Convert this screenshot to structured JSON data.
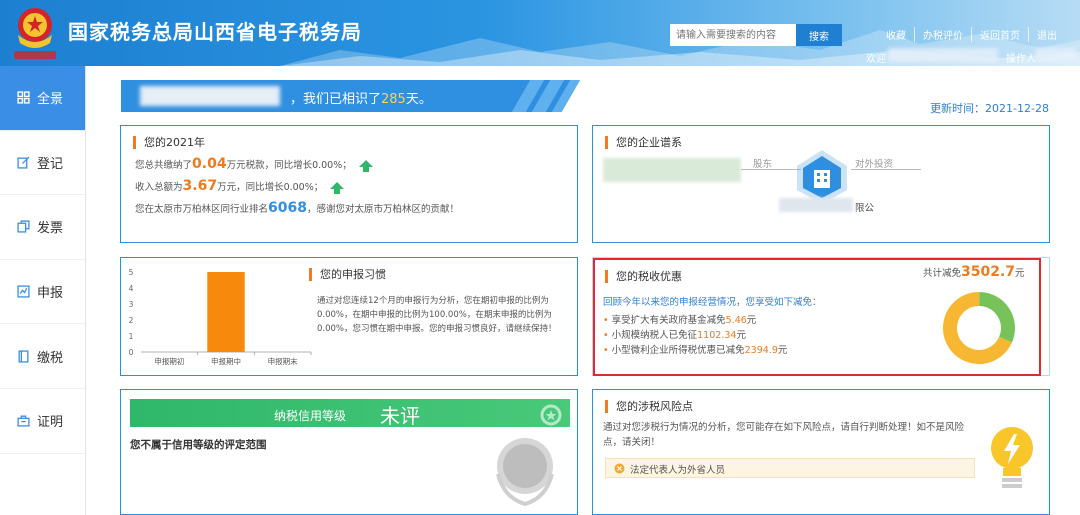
{
  "header": {
    "site_title": "国家税务总局山西省电子税务局",
    "search_placeholder": "请输入需要搜索的内容",
    "search_button": "搜索",
    "links": [
      "收藏",
      "办税评价",
      "返回首页",
      "退出"
    ],
    "welcome": "欢迎",
    "operator": "操作人"
  },
  "sidebar": {
    "items": [
      {
        "label": "全景",
        "icon": "grid-icon",
        "active": true
      },
      {
        "label": "登记",
        "icon": "edit-icon",
        "active": false
      },
      {
        "label": "发票",
        "icon": "copy-icon",
        "active": false
      },
      {
        "label": "申报",
        "icon": "chart-line-icon",
        "active": false
      },
      {
        "label": "缴税",
        "icon": "book-icon",
        "active": false
      },
      {
        "label": "证明",
        "icon": "certificate-icon",
        "active": false
      }
    ]
  },
  "banner": {
    "prefix": "，我们已相识了",
    "days": "285",
    "suffix": "天。"
  },
  "update_time": "更新时间：2021-12-28",
  "year_card": {
    "title": "您的2021年",
    "line1_a": "您总共缴纳了",
    "line1_num": "0.04",
    "line1_b": "万元税款，同比增长0.00%；",
    "line2_a": "收入总额为",
    "line2_num": "3.67",
    "line2_b": "万元，同比增长0.00%；",
    "line3_a": "您在太原市万柏林区同行业排名",
    "line3_num": "6068",
    "line3_b": "，感谢您对太原市万柏林区的贡献！"
  },
  "enterprise_card": {
    "title": "您的企业谱系",
    "shareholder": "股东",
    "investment": "对外投资",
    "company_suffix": "限公"
  },
  "declare_card": {
    "title": "您的申报习惯",
    "text": "通过对您连续12个月的申报行为分析，您在期初申报的比例为0.00%，在期中申报的比例为100.00%，在期末申报的比例为0.00%，您习惯在期中申报。您的申报习惯良好，请继续保持！",
    "text_lines": [
      "通过对您连续12个月的申报行为分析，您在期初申报的比例为",
      "0.00%，在期中申报的比例为100.00%，在期末申报的比例为",
      "0.00%，您习惯在期中申报。您的申报习惯良好，请继续保持！"
    ]
  },
  "chart_data": {
    "type": "bar",
    "categories": [
      "申报期初",
      "申报期中",
      "申报期末"
    ],
    "values": [
      0,
      5,
      0
    ],
    "ylim": [
      0,
      5
    ],
    "yticks": [
      "0",
      "1",
      "2",
      "3",
      "4",
      "5"
    ],
    "color": "#f7890c",
    "grid": false
  },
  "tax_card": {
    "title": "您的税收优惠",
    "total_label": "共计减免",
    "total_value": "3502.7",
    "total_unit": "元",
    "intro": "回顾今年以来您的申报经营情况，您享受如下减免：",
    "items": [
      {
        "text": "享受扩大有关政府基金减免",
        "value": "5.46",
        "unit": "元"
      },
      {
        "text": "小规模纳税人已免征",
        "value": "1102.34",
        "unit": "元"
      },
      {
        "text": "小型微利企业所得税优惠已减免",
        "value": "2394.9",
        "unit": "元"
      }
    ],
    "donut": {
      "values": [
        5.46,
        1102.34,
        2394.9
      ],
      "colors": [
        "#f7b733",
        "#78c25a",
        "#f7b733"
      ]
    }
  },
  "credit_card": {
    "label": "纳税信用等级",
    "value": "未评",
    "note": "您不属于信用等级的评定范围"
  },
  "risk_card": {
    "title": "您的涉税风险点",
    "text_line1": "通过对您涉税行为情况的分析，您可能存在如下风险点，请自行判断处理！如不是风险",
    "text_line2": "点，请关闭！",
    "item": "法定代表人为外省人员"
  }
}
